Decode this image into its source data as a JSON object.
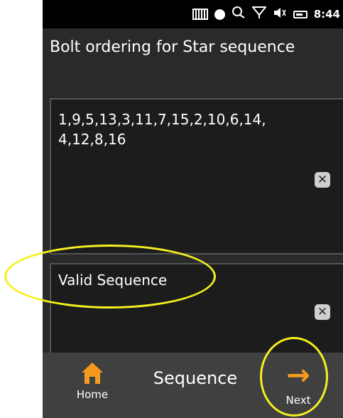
{
  "status_bar": {
    "icons": [
      "signal-icon",
      "record-dot-icon",
      "sync-icon",
      "no-signal-icon",
      "volume-icon",
      "battery-icon"
    ],
    "time": "8:44"
  },
  "page": {
    "title": "Bolt ordering for Star sequence"
  },
  "fields": {
    "sequence_value": "1,9,5,13,3,11,7,15,2,10,6,14, 4,12,8,16",
    "validation_message": "Valid Sequence",
    "clear_glyph": "✕"
  },
  "bottom_bar": {
    "home_label": "Home",
    "title": "Sequence",
    "next_label": "Next",
    "next_glyph": "→"
  },
  "colors": {
    "accent": "#f39a1f",
    "annotation": "#f5f01f",
    "background": "#2a2a2a"
  }
}
